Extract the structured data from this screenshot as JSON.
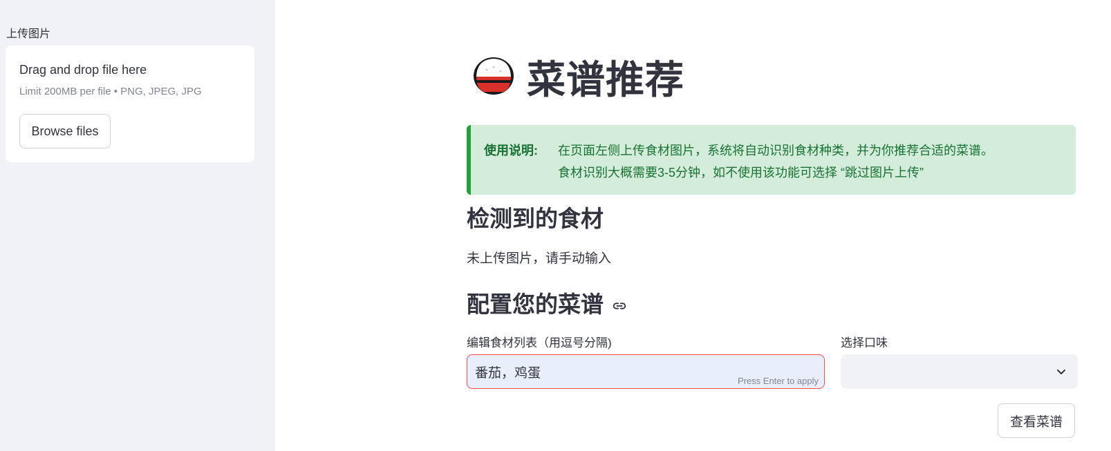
{
  "sidebar": {
    "upload_label": "上传图片",
    "dropzone": {
      "title": "Drag and drop file here",
      "limit": "Limit 200MB per file • PNG, JPEG, JPG",
      "browse_label": "Browse files"
    }
  },
  "main": {
    "title_icon": "rice-bowl-icon",
    "title": "菜谱推荐",
    "info": {
      "label": "使用说明:",
      "line1": "在页面左侧上传食材图片，系统将自动识别食材种类，并为你推荐合适的菜谱。",
      "line2": "食材识别大概需要3-5分钟，如不使用该功能可选择 “跳过图片上传”",
      "accent_color": "#21a33a",
      "background_color": "#d4ecda"
    },
    "detected": {
      "heading": "检测到的食材",
      "text": "未上传图片，请手动输入"
    },
    "config": {
      "heading": "配置您的菜谱",
      "heading_icon": "link-icon",
      "ingredients_label": "编辑食材列表（用逗号分隔)",
      "ingredients_value": "番茄，鸡蛋",
      "press_enter_hint": "Press Enter to apply",
      "taste_label": "选择口味",
      "taste_value": "",
      "taste_icon": "chevron-down-icon",
      "submit_label": "查看菜谱"
    }
  },
  "colors": {
    "sidebar_background": "#f0f2f6",
    "input_error_border": "#ff4b4b",
    "input_background": "#e8effb",
    "text": "#31333f"
  }
}
